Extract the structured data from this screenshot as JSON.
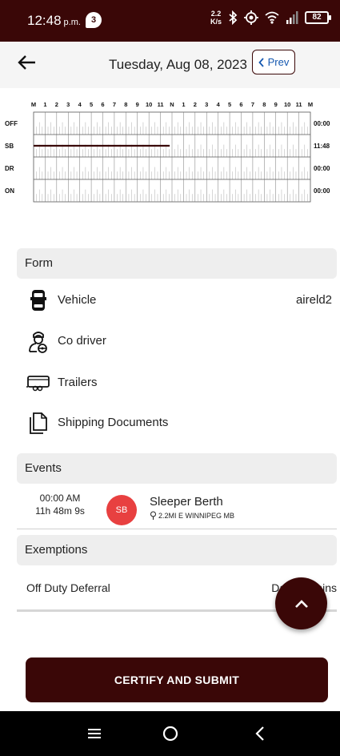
{
  "status_bar": {
    "time": "12:48",
    "ampm": "p.m.",
    "notification_count": "3",
    "net_speed_top": "2.2",
    "net_speed_bottom": "K/s",
    "battery": "82"
  },
  "header": {
    "date": "Tuesday, Aug 08, 2023",
    "prev_label": "Prev"
  },
  "graph": {
    "hour_labels": [
      "M",
      "1",
      "2",
      "3",
      "4",
      "5",
      "6",
      "7",
      "8",
      "9",
      "10",
      "11",
      "N",
      "1",
      "2",
      "3",
      "4",
      "5",
      "6",
      "7",
      "8",
      "9",
      "10",
      "11",
      "M"
    ],
    "rows": [
      {
        "label": "OFF",
        "total": "00:00"
      },
      {
        "label": "SB",
        "total": "11:48"
      },
      {
        "label": "DR",
        "total": "00:00"
      },
      {
        "label": "ON",
        "total": "00:00"
      }
    ],
    "segments": [
      {
        "status": "SB",
        "start_hour": 0,
        "end_hour": 11.8
      }
    ],
    "line_color": "#3a0707"
  },
  "form": {
    "title": "Form",
    "vehicle_label": "Vehicle",
    "vehicle_value": "aireld2",
    "codriver_label": "Co driver",
    "trailers_label": "Trailers",
    "shipping_label": "Shipping Documents"
  },
  "events": {
    "title": "Events",
    "items": [
      {
        "time": "00:00 AM",
        "duration": "11h 48m 9s",
        "badge": "SB",
        "status": "Sleeper Berth",
        "location": "2.2MI E WINNIPEG MB"
      }
    ]
  },
  "exemptions": {
    "title": "Exemptions",
    "label": "Off Duty Deferral",
    "value": "Day 0 0 mins"
  },
  "certify_button": "CERTIFY AND SUBMIT",
  "colors": {
    "brand": "#3a0707",
    "sb_badge": "#e84040",
    "link": "#1558b0"
  }
}
